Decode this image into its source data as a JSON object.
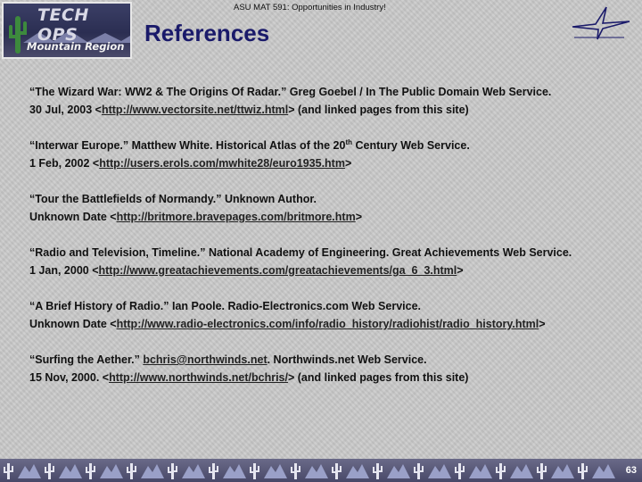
{
  "header": {
    "logo_top": "TECH OPS",
    "logo_bottom": "Mountain Region",
    "course": "ASU MAT 591: Opportunities in Industry!",
    "title": "References"
  },
  "references": [
    {
      "line1": "“The Wizard War: WW2 & The Origins Of Radar.” Greg Goebel / In The Public Domain Web Service.",
      "date": "30 Jul, 2003  <",
      "url": "http://www.vectorsite.net/ttwiz.html",
      "after": ">  (and linked pages from this site)"
    },
    {
      "line1a": "“Interwar Europe.” Matthew White. Historical Atlas of the 20",
      "line1sup": "th",
      "line1b": " Century Web Service.",
      "date": "1 Feb, 2002 <",
      "url": "http://users.erols.com/mwhite28/euro1935.htm",
      "after": ">"
    },
    {
      "line1": "“Tour the Battlefields of Normandy.” Unknown Author.",
      "date": "Unknown Date  <",
      "url": "http://britmore.bravepages.com/britmore.htm",
      "after": ">"
    },
    {
      "line1": "“Radio and Television, Timeline.” National Academy of Engineering. Great Achievements Web Service.",
      "date": "1 Jan, 2000  <",
      "url": "http://www.greatachievements.com/greatachievements/ga_6_3.html",
      "after": ">"
    },
    {
      "line1": "“A Brief History of Radio.” Ian Poole. Radio-Electronics.com Web Service.",
      "date": "Unknown Date  <",
      "url": "http://www.radio-electronics.com/info/radio_history/radiohist/radio_history.html",
      "after": ">"
    },
    {
      "line1a": "“Surfing the Aether.” ",
      "email": "bchris@northwinds.net",
      "line1b": ". Northwinds.net Web Service.",
      "date": "15 Nov, 2000. <",
      "url": "http://www.northwinds.net/bchris/",
      "after": "> (and linked pages from this site)"
    }
  ],
  "footer": {
    "page_number": "63",
    "icons": [
      "cactus-icon",
      "mountain-icon"
    ]
  },
  "colors": {
    "title": "#1a1a6a",
    "footer_bg": "#55557a",
    "logo_bg": "#2b2e52"
  }
}
